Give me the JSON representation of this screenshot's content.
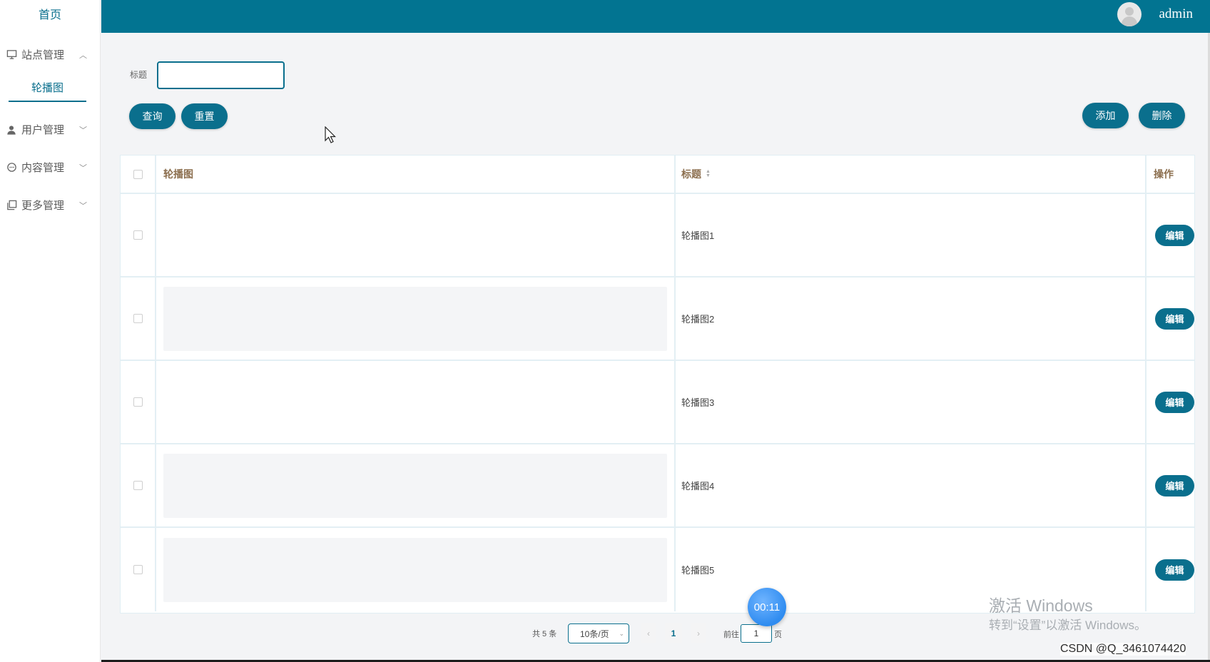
{
  "sidebar": {
    "home": "首页",
    "groups": [
      {
        "label": "站点管理",
        "icon": "monitor-icon",
        "chevron": "^",
        "expanded": true
      },
      {
        "label": "用户管理",
        "icon": "user-icon",
        "chevron": "⌄"
      },
      {
        "label": "内容管理",
        "icon": "chat-icon",
        "chevron": "⌄"
      },
      {
        "label": "更多管理",
        "icon": "copy-icon",
        "chevron": "⌄"
      }
    ],
    "active_sub": "轮播图"
  },
  "topbar": {
    "username": "admin",
    "color": "#027491"
  },
  "search": {
    "label": "标题",
    "value": "",
    "query_label": "查询",
    "reset_label": "重置"
  },
  "toolbar": {
    "add_label": "添加",
    "delete_label": "删除"
  },
  "table": {
    "columns": [
      "轮播图",
      "标题",
      "操作"
    ],
    "rows": [
      {
        "title": "轮播图1",
        "edit_label": "编辑",
        "has_image": false
      },
      {
        "title": "轮播图2",
        "edit_label": "编辑",
        "has_image": true
      },
      {
        "title": "轮播图3",
        "edit_label": "编辑",
        "has_image": false
      },
      {
        "title": "轮播图4",
        "edit_label": "编辑",
        "has_image": true
      },
      {
        "title": "轮播图5",
        "edit_label": "编辑",
        "has_image": true
      }
    ]
  },
  "pagination": {
    "total_text": "共 5 条",
    "page_size": "10条/页",
    "current_page": "1",
    "goto_label": "前往",
    "jump_value": "1",
    "page_unit": "页"
  },
  "overlay": {
    "timer": "00:11",
    "activate_title": "激活 Windows",
    "activate_sub": "转到“设置”以激活 Windows。",
    "csdn": "CSDN @Q_3461074420"
  },
  "colors": {
    "accent": "#0a6f8d",
    "header_text": "#8c6f4f"
  }
}
